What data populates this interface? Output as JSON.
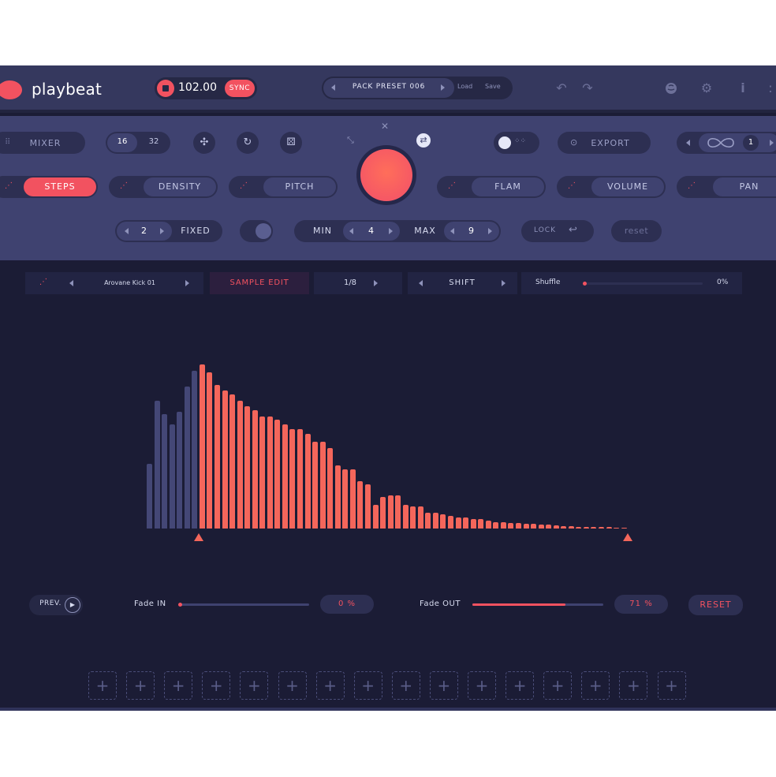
{
  "header": {
    "app_name": "playbeat",
    "bpm": "102.00",
    "sync_label": "SYNC",
    "preset_name": "PACK PRESET 006",
    "load_label": "Load",
    "save_label": "Save"
  },
  "controls": {
    "mixer_label": "MIXER",
    "steps_16": "16",
    "steps_32": "32",
    "export_label": "EXPORT",
    "loop_count": "1",
    "params": {
      "steps": "STEPS",
      "density": "DENSITY",
      "pitch": "PITCH",
      "flam": "FLAM",
      "volume": "VOLUME",
      "pan": "PAN"
    },
    "fixed_value": "2",
    "fixed_label": "FIXED",
    "min_label": "MIN",
    "min_value": "4",
    "max_label": "MAX",
    "max_value": "9",
    "lock_label": "LOCK",
    "reset_label": "reset"
  },
  "sample": {
    "name": "Arovane Kick 01",
    "edit_label": "SAMPLE EDIT",
    "division": "1/8",
    "shift_label": "SHIFT",
    "shuffle_label": "Shuffle",
    "shuffle_value": "0%",
    "shuffle_level": 0
  },
  "waveform": {
    "dim_heights": [
      82,
      162,
      145,
      132,
      148,
      180,
      200
    ],
    "active_heights": [
      208,
      198,
      182,
      175,
      170,
      162,
      155,
      150,
      142,
      142,
      138,
      132,
      126,
      126,
      120,
      110,
      110,
      102,
      80,
      75,
      75,
      60,
      56,
      30,
      40,
      42,
      42,
      30,
      28,
      28,
      20,
      20,
      18,
      16,
      14,
      14,
      12,
      12,
      10,
      8,
      8,
      7,
      7,
      6,
      6,
      5,
      5,
      4,
      3,
      3,
      2,
      2,
      2,
      2,
      2,
      1,
      1
    ],
    "dim_color": "#444776",
    "active_color": "#f4665b"
  },
  "fade": {
    "prev_label": "PREV.",
    "fade_in_label": "Fade IN",
    "fade_in_value": "0 %",
    "fade_in_level": 0,
    "fade_out_label": "Fade OUT",
    "fade_out_value": "71 %",
    "fade_out_level": 0.71,
    "reset_label": "RESET"
  },
  "slots": {
    "count": 16,
    "plus": "+"
  },
  "colors": {
    "accent": "#f25260",
    "panel": "#3f4270",
    "background": "#1b1c35"
  },
  "icons": {
    "undo": "↶",
    "redo": "↷",
    "info": "i",
    "settings": "⚙",
    "refresh": "↻",
    "dice": "⚄",
    "export": "⊙"
  }
}
